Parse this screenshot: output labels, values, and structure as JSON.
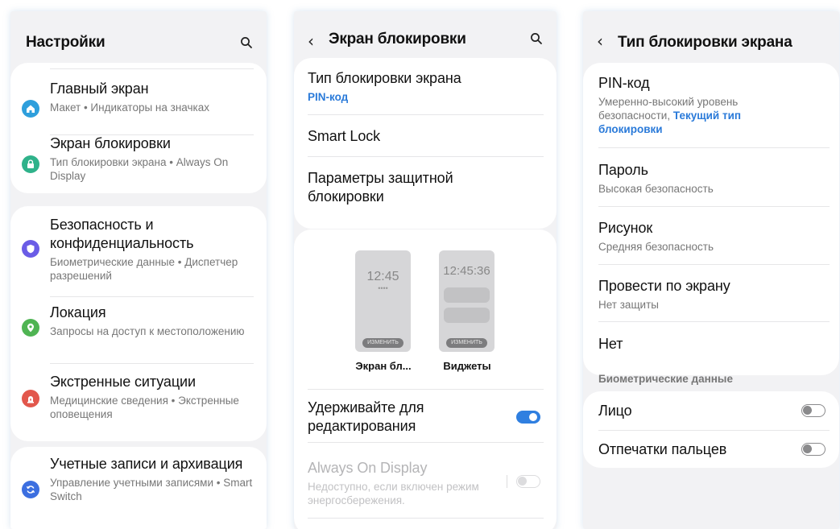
{
  "settings": {
    "title": "Настройки",
    "groups": [
      {
        "items": [
          {
            "title": "Главный экран",
            "subtitle": "Макет • Индикаторы на значках",
            "icon": "home-icon",
            "color": "#2e9fdc"
          },
          {
            "title": "Экран блокировки",
            "subtitle": "Тип блокировки экрана • Always On Display",
            "icon": "lock-icon",
            "color": "#2fb28a"
          }
        ]
      },
      {
        "items": [
          {
            "title": "Безопасность и конфиденциальность",
            "subtitle": "Биометрические данные • Диспетчер разрешений",
            "icon": "shield-icon",
            "color": "#6a5ce6"
          },
          {
            "title": "Локация",
            "subtitle": "Запросы на доступ к местоположению",
            "icon": "location-pin-icon",
            "color": "#4fb453"
          },
          {
            "title": "Экстренные ситуации",
            "subtitle": "Медицинские сведения • Экстренные оповещения",
            "icon": "alert-icon",
            "color": "#e2574c"
          }
        ]
      },
      {
        "items": [
          {
            "title": "Учетные записи и архивация",
            "subtitle": "Управление учетными записями • Smart Switch",
            "icon": "sync-icon",
            "color": "#3c6fe0"
          }
        ]
      }
    ]
  },
  "lockscreen": {
    "title": "Экран блокировки",
    "items": [
      {
        "title": "Тип блокировки экрана",
        "subtitle": "PIN-код"
      },
      {
        "title": "Smart Lock"
      },
      {
        "title": "Параметры защитной блокировки"
      }
    ],
    "previews": [
      {
        "time": "12:45",
        "dots": "••••",
        "edit": "ИЗМЕНИТЬ",
        "label": "Экран бл..."
      },
      {
        "time": "12:45:36",
        "edit": "ИЗМЕНИТЬ",
        "label": "Виджеты"
      }
    ],
    "hold_edit": {
      "title": "Удерживайте для редактирования",
      "on": true
    },
    "aod": {
      "title": "Always On Display",
      "subtitle": "Недоступно, если включен режим энергосбережения.",
      "on": false
    }
  },
  "locktype": {
    "title": "Тип блокировки экрана",
    "items": [
      {
        "title": "PIN-код",
        "subtitle": "Умеренно-высокий уровень безопасности,",
        "current": "Текущий тип блокировки"
      },
      {
        "title": "Пароль",
        "subtitle": "Высокая безопасность"
      },
      {
        "title": "Рисунок",
        "subtitle": "Средняя безопасность"
      },
      {
        "title": "Провести по экрану",
        "subtitle": "Нет защиты"
      },
      {
        "title": "Нет"
      }
    ],
    "biometrics_header": "Биометрические данные",
    "biometrics": [
      {
        "title": "Лицо",
        "on": false
      },
      {
        "title": "Отпечатки пальцев",
        "on": false
      }
    ]
  },
  "colors": {
    "accent": "#2a7ad9",
    "toggle_on": "#2f7fe0",
    "toggle_off": "#b9b9bb"
  }
}
